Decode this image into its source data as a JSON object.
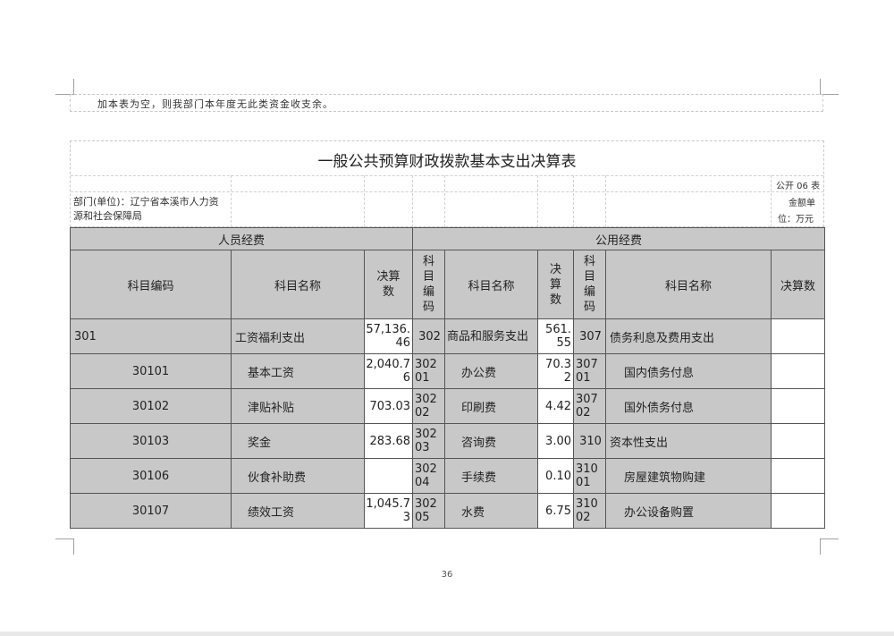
{
  "note": "加本表为空，则我部门本年度无此类资金收支余。",
  "title": "一般公共预算财政拨款基本支出决算表",
  "table_no": "公开 06 表",
  "unit_line1": "金额单",
  "unit_line2": "位：万元",
  "department": "部门(单位)：辽宁省本溪市人力资源和社会保障局",
  "groups": {
    "personnel": "人员经费",
    "public": "公用经费"
  },
  "headers": {
    "code": "科目编码",
    "name": "科目名称",
    "amount": "决算数",
    "code_vertical": "科目编码",
    "amount_vertical": "决算数"
  },
  "rows": [
    {
      "p_code": "301",
      "p_name": "工资福利支出",
      "p_amt": "57,136.46",
      "g_code": "302",
      "g_name": "商品和服务支出",
      "g_amt": "561.55",
      "o_code": "307",
      "o_name": "债务利息及费用支出",
      "o_amt": ""
    },
    {
      "p_code": "30101",
      "p_name": "基本工资",
      "p_amt": "2,040.76",
      "g_code": "30201",
      "g_name": "办公费",
      "g_amt": "70.32",
      "o_code": "30701",
      "o_name": "国内债务付息",
      "o_amt": ""
    },
    {
      "p_code": "30102",
      "p_name": "津贴补贴",
      "p_amt": "703.03",
      "g_code": "30202",
      "g_name": "印刷费",
      "g_amt": "4.42",
      "o_code": "30702",
      "o_name": "国外债务付息",
      "o_amt": ""
    },
    {
      "p_code": "30103",
      "p_name": "奖金",
      "p_amt": "283.68",
      "g_code": "30203",
      "g_name": "咨询费",
      "g_amt": "3.00",
      "o_code": "310",
      "o_name": "资本性支出",
      "o_amt": ""
    },
    {
      "p_code": "30106",
      "p_name": "伙食补助费",
      "p_amt": "",
      "g_code": "30204",
      "g_name": "手续费",
      "g_amt": "0.10",
      "o_code": "31001",
      "o_name": "房屋建筑物购建",
      "o_amt": ""
    },
    {
      "p_code": "30107",
      "p_name": "绩效工资",
      "p_amt": "1,045.73",
      "g_code": "30205",
      "g_name": "水费",
      "g_amt": "6.75",
      "o_code": "31002",
      "o_name": "办公设备购置",
      "o_amt": ""
    }
  ],
  "page_number": "36"
}
